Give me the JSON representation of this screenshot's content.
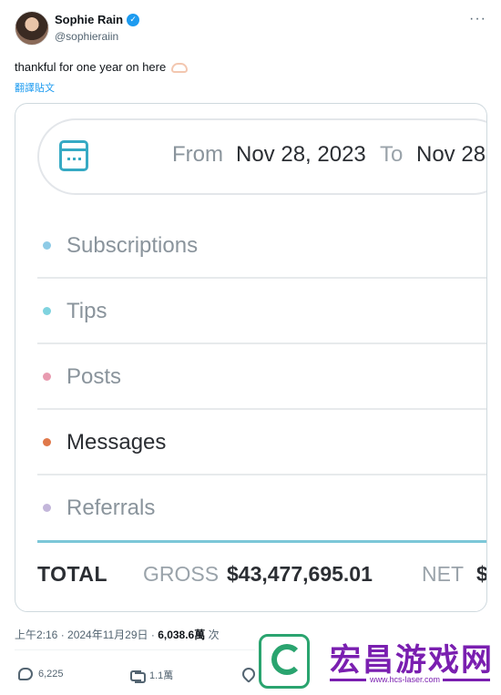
{
  "author": {
    "display_name": "Sophie Rain",
    "handle": "@sophieraiin",
    "verified": true
  },
  "header": {
    "more_icon": "more-dots-icon"
  },
  "tweet": {
    "text": "thankful for one year on here",
    "emoji_icon": "heart-hands-icon",
    "translate_label": "翻譯貼文"
  },
  "earnings": {
    "from_label": "From",
    "from_date": "Nov 28, 2023",
    "to_label": "To",
    "to_date": "Nov 28,",
    "categories": [
      {
        "label": "Subscriptions",
        "color": "#8ecbe6"
      },
      {
        "label": "Tips",
        "color": "#7fd3df"
      },
      {
        "label": "Posts",
        "color": "#e89bb0"
      },
      {
        "label": "Messages",
        "color": "#e0784a"
      },
      {
        "label": "Referrals",
        "color": "#c3b6da"
      }
    ],
    "total_label": "TOTAL",
    "gross_label": "GROSS",
    "gross_value": "$43,477,695.01",
    "net_label": "NET",
    "net_value": "$"
  },
  "meta": {
    "time": "上午2:16 · 2024年11月29日 · ",
    "views": "6,038.6萬",
    "views_suffix": " 次"
  },
  "actions": {
    "replies": "6,225",
    "retweets": "1.1萬"
  },
  "watermark": {
    "title": "宏昌游戏网",
    "url": "www.hcs-laser.com"
  }
}
